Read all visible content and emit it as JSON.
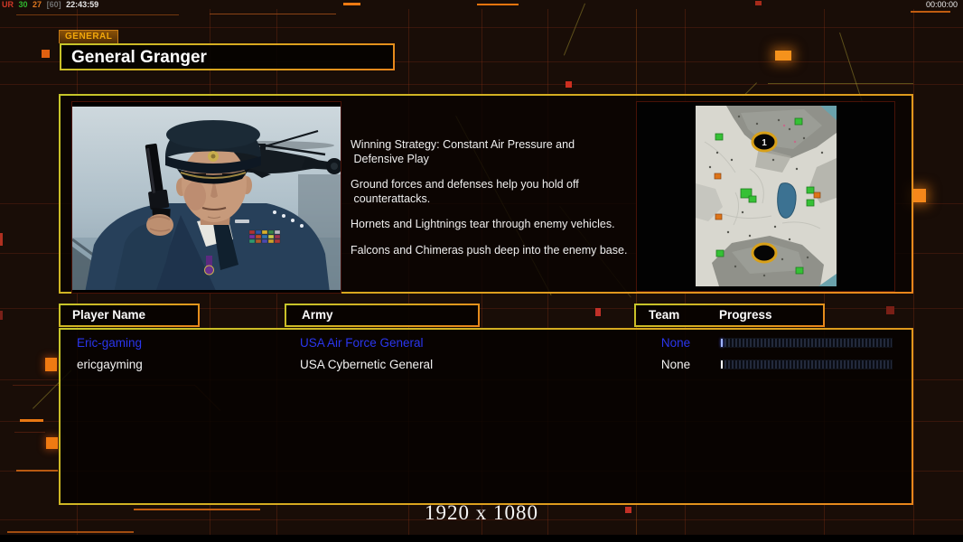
{
  "hud": {
    "debug": {
      "ur": "UR",
      "fps": "30",
      "latency": "27",
      "cap": "[60]",
      "time": "22:43:59"
    },
    "clock": "00:00:00",
    "resolution_label": "1920 x 1080"
  },
  "general_panel": {
    "tab_label": "GENERAL",
    "title": "General Granger",
    "strategy_lines": [
      "Winning Strategy: Constant Air Pressure and\n Defensive Play",
      "Ground forces and defenses help you hold off\n counterattacks.",
      "Hornets and Lightnings tear through enemy vehicles.",
      "Falcons and Chimeras push deep into the enemy base."
    ],
    "minimap": {
      "start_position_1_label": "1"
    }
  },
  "player_list": {
    "headers": {
      "player_name": "Player Name",
      "army": "Army",
      "team": "Team",
      "progress": "Progress"
    },
    "rows": [
      {
        "name": "Eric-gaming",
        "army": "USA Air Force General",
        "team": "None",
        "progress_percent": 1
      },
      {
        "name": "ericgayming",
        "army": "USA Cybernetic General",
        "team": "None",
        "progress_percent": 1
      }
    ]
  },
  "colors": {
    "accent_gold": "#c6c62a",
    "accent_orange": "#e9851b",
    "row_blue": "#2a36ee",
    "row_white": "#f2f2f2",
    "tab_text": "#f2a70a",
    "hud_red": "#d03828",
    "hud_green": "#30b830",
    "hud_orange": "#e07820",
    "hud_gray": "#6e6e6e",
    "minimap_green_marker": "#35c135",
    "minimap_orange_marker": "#dd7418",
    "start_ring_gold": "#d8a018"
  }
}
